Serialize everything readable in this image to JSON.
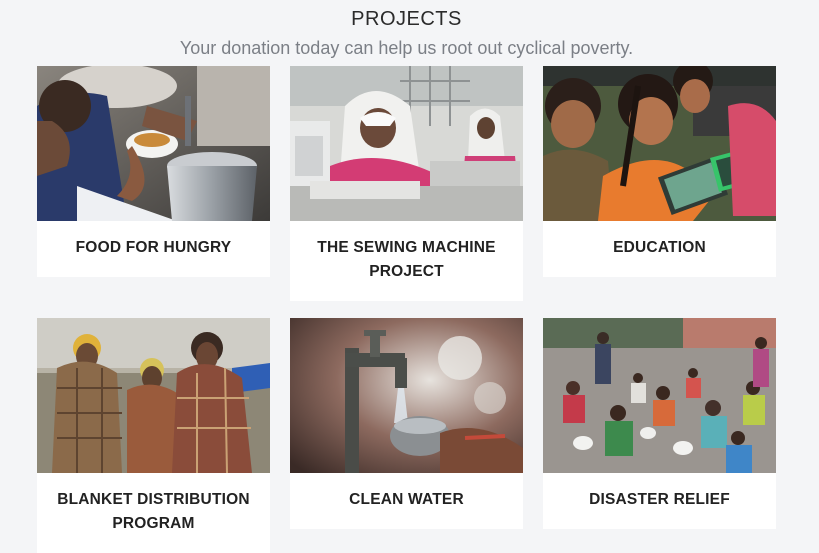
{
  "header": {
    "title": "PROJECTS",
    "subtitle": "Your donation today can help us root out cyclical poverty."
  },
  "projects": [
    {
      "title": "FOOD FOR HUNGRY",
      "image": "food-serving-photo"
    },
    {
      "title": "THE SEWING MACHINE PROJECT",
      "image": "sewing-workers-photo"
    },
    {
      "title": "EDUCATION",
      "image": "children-studying-photo"
    },
    {
      "title": "BLANKET DISTRIBUTION PROGRAM",
      "image": "women-in-blankets-photo"
    },
    {
      "title": "CLEAN WATER",
      "image": "water-tap-photo"
    },
    {
      "title": "DISASTER RELIEF",
      "image": "relief-crowd-photo"
    }
  ]
}
